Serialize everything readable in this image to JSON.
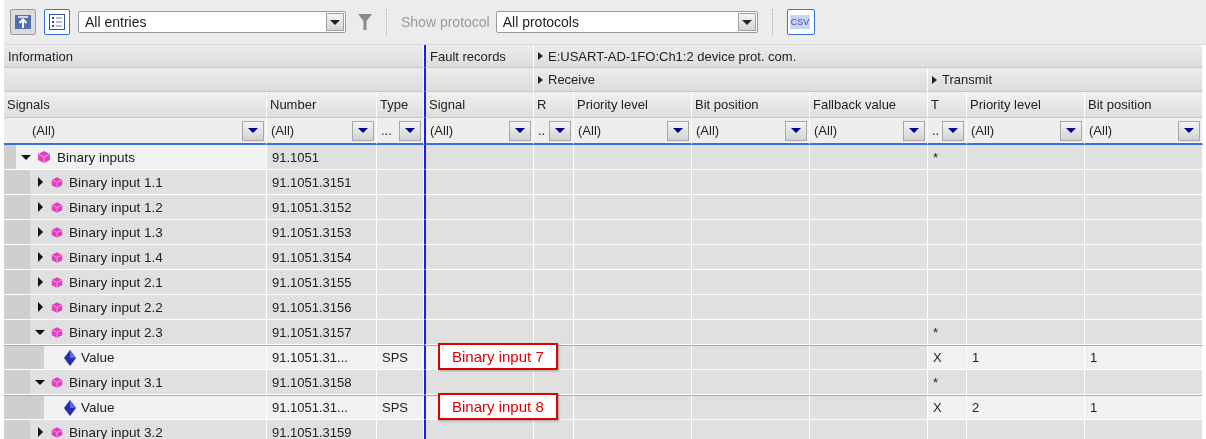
{
  "toolbar": {
    "entries_filter": {
      "value": "All entries"
    },
    "protocol_label": "Show protocol",
    "protocol_filter": {
      "value": "All protocols"
    },
    "export_label": "CSV"
  },
  "header_groups": {
    "information": "Information",
    "fault_records": "Fault records",
    "device": "E:USART-AD-1FO:Ch1:2 device prot. com.",
    "receive": "Receive",
    "transmit": "Transmit"
  },
  "columns": [
    {
      "label": "Signals",
      "filter": "(All)"
    },
    {
      "label": "Number",
      "filter": "(All)"
    },
    {
      "label": "Type",
      "filter": "..."
    },
    {
      "label": "Signal",
      "filter": "(All)"
    },
    {
      "label": "R",
      "filter": ".."
    },
    {
      "label": "Priority level",
      "filter": "(All)"
    },
    {
      "label": "Bit position",
      "filter": "(All)"
    },
    {
      "label": "Fallback value",
      "filter": "(All)"
    },
    {
      "label": "T",
      "filter": ".."
    },
    {
      "label": "Priority level",
      "filter": "(All)"
    },
    {
      "label": "Bit position",
      "filter": "(All)"
    }
  ],
  "rows": [
    {
      "kind": "group",
      "name": "Binary inputs",
      "number": "91.1051",
      "t": "*",
      "expanded": true,
      "children": [
        {
          "kind": "group",
          "name": "Binary input  1.1",
          "number": "91.1051.3151",
          "expanded": false
        },
        {
          "kind": "group",
          "name": "Binary input  1.2",
          "number": "91.1051.3152",
          "expanded": false
        },
        {
          "kind": "group",
          "name": "Binary input  1.3",
          "number": "91.1051.3153",
          "expanded": false
        },
        {
          "kind": "group",
          "name": "Binary input  1.4",
          "number": "91.1051.3154",
          "expanded": false
        },
        {
          "kind": "group",
          "name": "Binary input  2.1",
          "number": "91.1051.3155",
          "expanded": false
        },
        {
          "kind": "group",
          "name": "Binary input  2.2",
          "number": "91.1051.3156",
          "expanded": false
        },
        {
          "kind": "group",
          "name": "Binary input  2.3",
          "number": "91.1051.3157",
          "t": "*",
          "expanded": true,
          "children": [
            {
              "kind": "value",
              "name": "Value",
              "number": "91.1051.31...",
              "type": "SPS",
              "signal": "Binary input 7",
              "t": "X",
              "priority": "1",
              "bit": "1"
            }
          ]
        },
        {
          "kind": "group",
          "name": "Binary input  3.1",
          "number": "91.1051.3158",
          "t": "*",
          "expanded": true,
          "children": [
            {
              "kind": "value",
              "name": "Value",
              "number": "91.1051.31...",
              "type": "SPS",
              "signal": "Binary input 8",
              "t": "X",
              "priority": "2",
              "bit": "1"
            }
          ]
        },
        {
          "kind": "group",
          "name": "Binary input  3.2",
          "number": "91.1051.3159",
          "expanded": false
        }
      ]
    }
  ]
}
